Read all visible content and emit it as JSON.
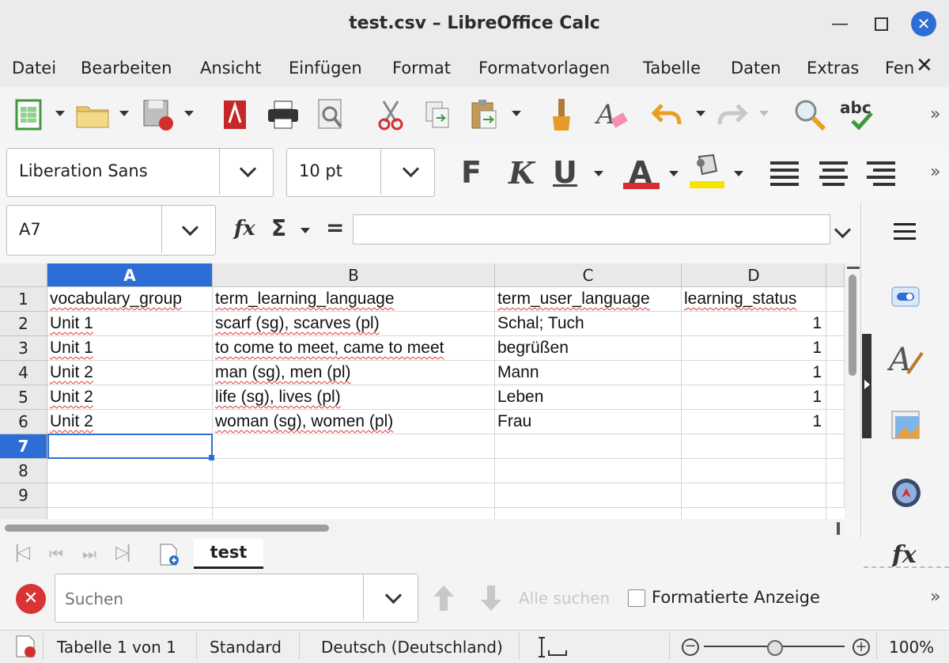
{
  "window": {
    "title": "test.csv – LibreOffice Calc"
  },
  "menu": [
    "Datei",
    "Bearbeiten",
    "Ansicht",
    "Einfügen",
    "Format",
    "Formatvorlagen",
    "Tabelle",
    "Daten",
    "Extras",
    "Fen"
  ],
  "format_toolbar": {
    "font_name": "Liberation Sans",
    "font_size": "10 pt",
    "bold": "F",
    "italic": "K",
    "underline": "U",
    "font_color": "A",
    "font_color_hex": "#d32f2f",
    "highlight_hex": "#f5e400"
  },
  "formula_bar": {
    "name_box": "A7",
    "function_wizard": "fx",
    "sum": "Σ",
    "equals": "=",
    "formula": ""
  },
  "sheet": {
    "columns": [
      "A",
      "B",
      "C",
      "D"
    ],
    "rows": [
      "1",
      "2",
      "3",
      "4",
      "5",
      "6",
      "7",
      "8",
      "9"
    ],
    "cells": [
      [
        "vocabulary_group",
        "term_learning_language",
        "term_user_language",
        "learning_status"
      ],
      [
        "Unit 1",
        "scarf (sg), scarves (pl)",
        "Schal; Tuch",
        "1"
      ],
      [
        "Unit 1",
        "to come to meet, came to meet",
        "begrüßen",
        "1"
      ],
      [
        "Unit 2",
        "man (sg), men (pl)",
        "Mann",
        "1"
      ],
      [
        "Unit 2",
        "life (sg), lives (pl)",
        "Leben",
        "1"
      ],
      [
        "Unit 2",
        "woman (sg), women (pl)",
        "Frau",
        "1"
      ]
    ],
    "active_cell": "A7"
  },
  "sheet_tabs": {
    "active": "test"
  },
  "find_bar": {
    "placeholder": "Suchen",
    "find_all": "Alle suchen",
    "formatted_display": "Formatierte Anzeige"
  },
  "status_bar": {
    "sheet_info": "Tabelle 1 von 1",
    "page_style": "Standard",
    "language": "Deutsch (Deutschland)",
    "zoom": "100%",
    "zoom_level_percent": 100
  }
}
